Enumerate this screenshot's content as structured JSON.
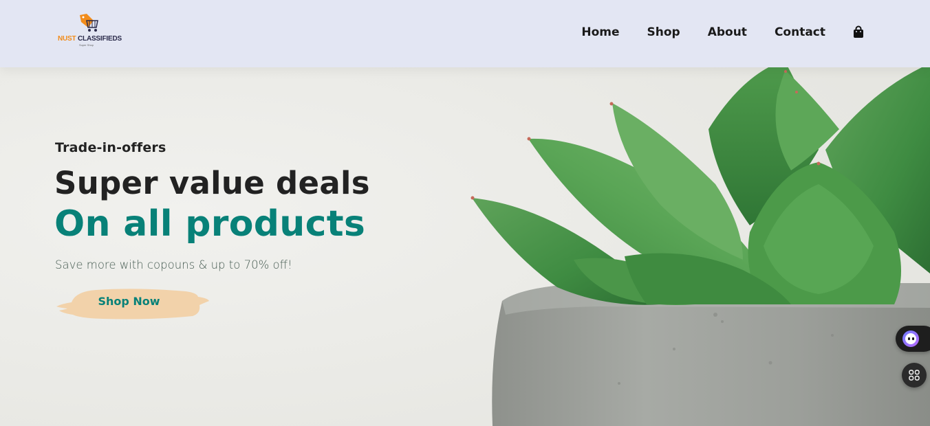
{
  "brand": {
    "logo_word1": "NUST",
    "logo_word2": "CLASSIFIEDS",
    "logo_tagline": "Super Shop",
    "logo_icon": "cart-tag-icon",
    "accent_orange": "#f28c1b"
  },
  "nav": {
    "items": [
      "Home",
      "Shop",
      "About",
      "Contact"
    ],
    "cart_icon": "shopping-bag-icon"
  },
  "hero": {
    "kicker": "Trade-in-offers",
    "headline": "Super value deals",
    "highlight": "On all products",
    "subtext": "Save more with copouns & up to 70% off!",
    "cta_label": "Shop Now",
    "image": "succulent-in-concrete-pot",
    "accent_teal": "#088178",
    "cta_bg": "#f2d2aa"
  },
  "widgets": {
    "apps_icon": "grid-apps-icon",
    "assistant_icon": "assistant-bot-icon"
  }
}
